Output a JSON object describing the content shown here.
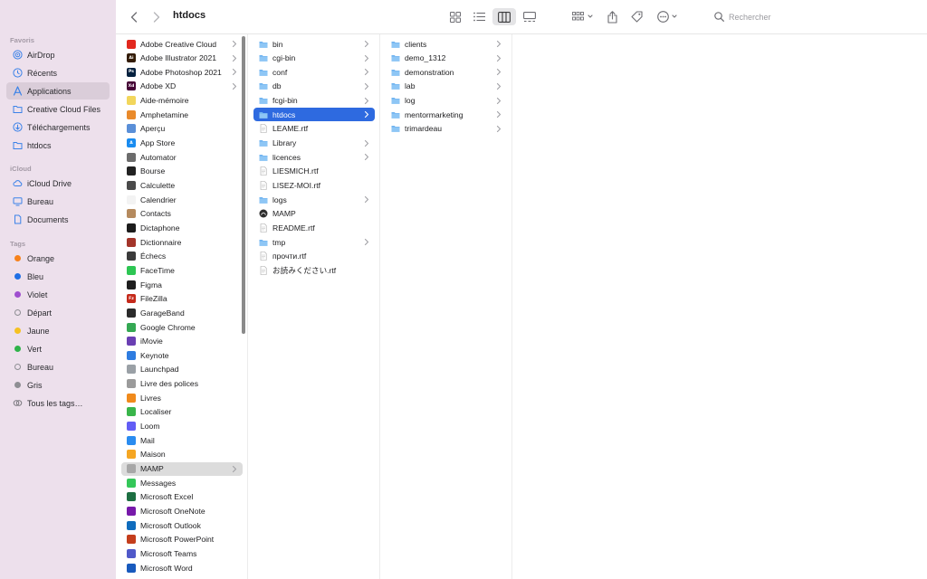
{
  "window": {
    "title": "htdocs",
    "search_placeholder": "Rechercher"
  },
  "sidebar": {
    "favorites_header": "Favoris",
    "favorites": [
      {
        "label": "AirDrop",
        "icon": "airdrop-icon"
      },
      {
        "label": "Récents",
        "icon": "clock-icon"
      },
      {
        "label": "Applications",
        "icon": "applications-icon",
        "selected": true
      },
      {
        "label": "Creative Cloud Files",
        "icon": "folder-icon"
      },
      {
        "label": "Téléchargements",
        "icon": "download-icon"
      },
      {
        "label": "htdocs",
        "icon": "folder-icon"
      }
    ],
    "icloud_header": "iCloud",
    "icloud": [
      {
        "label": "iCloud Drive",
        "icon": "cloud-icon"
      },
      {
        "label": "Bureau",
        "icon": "desktop-icon"
      },
      {
        "label": "Documents",
        "icon": "document-icon"
      }
    ],
    "tags_header": "Tags",
    "tags": [
      {
        "label": "Orange",
        "color": "#f7821b"
      },
      {
        "label": "Bleu",
        "color": "#1f6fe5"
      },
      {
        "label": "Violet",
        "color": "#9f4fcf"
      },
      {
        "label": "Départ",
        "color": ""
      },
      {
        "label": "Jaune",
        "color": "#f5c122"
      },
      {
        "label": "Vert",
        "color": "#2fb34a"
      },
      {
        "label": "Bureau",
        "color": ""
      },
      {
        "label": "Gris",
        "color": "#8e8e93"
      },
      {
        "label": "Tous les tags…",
        "color": "all"
      }
    ]
  },
  "column1": [
    {
      "label": "Adobe Creative Cloud",
      "icon": "folder-app",
      "color": "#e2281e",
      "chev": true
    },
    {
      "label": "Adobe Illustrator 2021",
      "icon": "folder-app",
      "color": "#331c05",
      "text": "Ai",
      "chev": true
    },
    {
      "label": "Adobe Photoshop 2021",
      "icon": "folder-app",
      "color": "#04213f",
      "text": "Ps",
      "chev": true
    },
    {
      "label": "Adobe XD",
      "icon": "folder-app",
      "color": "#450135",
      "text": "Xd",
      "chev": true
    },
    {
      "label": "Aide-mémoire",
      "color": "#f2d65c"
    },
    {
      "label": "Amphetamine",
      "color": "#e98a2b"
    },
    {
      "label": "Aperçu",
      "color": "#5a8fd8"
    },
    {
      "label": "App Store",
      "color": "#1a8cf0",
      "text": "A"
    },
    {
      "label": "Automator",
      "color": "#6c6c6c"
    },
    {
      "label": "Bourse",
      "color": "#222222"
    },
    {
      "label": "Calculette",
      "color": "#4a4a4a"
    },
    {
      "label": "Calendrier",
      "color": "#f3f3f3"
    },
    {
      "label": "Contacts",
      "color": "#b58a5e"
    },
    {
      "label": "Dictaphone",
      "color": "#1c1c1c"
    },
    {
      "label": "Dictionnaire",
      "color": "#a3352a"
    },
    {
      "label": "Échecs",
      "color": "#3b3b3b"
    },
    {
      "label": "FaceTime",
      "color": "#2dc653"
    },
    {
      "label": "Figma",
      "color": "#1e1e1e"
    },
    {
      "label": "FileZilla",
      "color": "#c52a1b",
      "text": "Fz"
    },
    {
      "label": "GarageBand",
      "color": "#2b2b2b"
    },
    {
      "label": "Google Chrome",
      "color": "#34a853"
    },
    {
      "label": "iMovie",
      "color": "#6a3fb3"
    },
    {
      "label": "Keynote",
      "color": "#2e7ce0"
    },
    {
      "label": "Launchpad",
      "color": "#9aa0a6"
    },
    {
      "label": "Livre des polices",
      "color": "#9b9b9b"
    },
    {
      "label": "Livres",
      "color": "#f08a1c"
    },
    {
      "label": "Localiser",
      "color": "#39b54a"
    },
    {
      "label": "Loom",
      "color": "#625df5"
    },
    {
      "label": "Mail",
      "color": "#2a8cf0"
    },
    {
      "label": "Maison",
      "color": "#f5a623"
    },
    {
      "label": "MAMP",
      "icon": "folder-app",
      "color": "#a7a7a7",
      "chev": true,
      "selected_gray": true
    },
    {
      "label": "Messages",
      "color": "#34c759"
    },
    {
      "label": "Microsoft Excel",
      "color": "#1d6f42"
    },
    {
      "label": "Microsoft OneNote",
      "color": "#7719aa"
    },
    {
      "label": "Microsoft Outlook",
      "color": "#0f6cbd"
    },
    {
      "label": "Microsoft PowerPoint",
      "color": "#c43e1c"
    },
    {
      "label": "Microsoft Teams",
      "color": "#5059c9"
    },
    {
      "label": "Microsoft Word",
      "color": "#185abd"
    }
  ],
  "column2": [
    {
      "label": "bin",
      "type": "folder",
      "chev": true
    },
    {
      "label": "cgi-bin",
      "type": "folder",
      "chev": true
    },
    {
      "label": "conf",
      "type": "folder",
      "chev": true
    },
    {
      "label": "db",
      "type": "folder",
      "chev": true
    },
    {
      "label": "fcgi-bin",
      "type": "folder",
      "chev": true
    },
    {
      "label": "htdocs",
      "type": "folder",
      "chev": true,
      "selected": true
    },
    {
      "label": "LEAME.rtf",
      "type": "file"
    },
    {
      "label": "Library",
      "type": "folder",
      "chev": true
    },
    {
      "label": "licences",
      "type": "folder",
      "chev": true
    },
    {
      "label": "LIESMICH.rtf",
      "type": "file"
    },
    {
      "label": "LISEZ-MOI.rtf",
      "type": "file"
    },
    {
      "label": "logs",
      "type": "folder",
      "chev": true
    },
    {
      "label": "MAMP",
      "type": "app"
    },
    {
      "label": "README.rtf",
      "type": "file"
    },
    {
      "label": "tmp",
      "type": "folder",
      "chev": true
    },
    {
      "label": "прочти.rtf",
      "type": "file"
    },
    {
      "label": "お読みください.rtf",
      "type": "file"
    }
  ],
  "column3": [
    {
      "label": "clients",
      "type": "folder",
      "chev": true
    },
    {
      "label": "demo_1312",
      "type": "folder",
      "chev": true
    },
    {
      "label": "demonstration",
      "type": "folder",
      "chev": true
    },
    {
      "label": "lab",
      "type": "folder",
      "chev": true
    },
    {
      "label": "log",
      "type": "folder",
      "chev": true
    },
    {
      "label": "mentormarketing",
      "type": "folder",
      "chev": true
    },
    {
      "label": "trimardeau",
      "type": "folder",
      "chev": true
    }
  ]
}
